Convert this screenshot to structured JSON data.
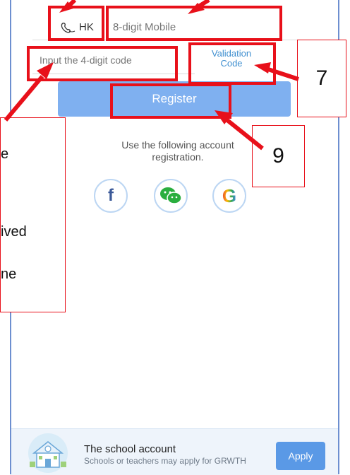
{
  "form": {
    "country_code": "HK",
    "mobile_placeholder": "8-digit Mobile",
    "code_placeholder": "Input the 4-digit code",
    "validation_line1": "Validation",
    "validation_line2": "Code",
    "register_label": "Register"
  },
  "social": {
    "intro_line1": "Use the following account",
    "intro_line2": "registration.",
    "facebook": "f",
    "google": "G"
  },
  "school": {
    "title": "The school account",
    "subtitle": "Schools or teachers may apply for GRWTH",
    "apply_label": "Apply"
  },
  "annotations": {
    "label_7": "7",
    "label_9": "9",
    "callout_line1": "e",
    "callout_line2": "ived",
    "callout_line3": "ne"
  },
  "colors": {
    "accent": "#7fb0f0",
    "annotation_red": "#e8101a",
    "link_blue": "#3f8fd0"
  }
}
